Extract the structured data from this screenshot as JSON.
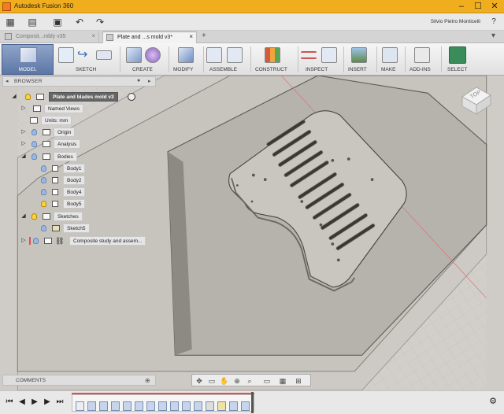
{
  "app": {
    "title": "Autodesk Fusion 360",
    "user": "Silvio Pietro Monticelli"
  },
  "tabs": [
    {
      "label": "Composit...mbly v35"
    },
    {
      "label": "Plate and ...s mold v3*"
    }
  ],
  "toolbar": {
    "mode": "MODEL",
    "groups": [
      {
        "label": "SKETCH"
      },
      {
        "label": "CREATE"
      },
      {
        "label": "MODIFY"
      },
      {
        "label": "ASSEMBLE"
      },
      {
        "label": "CONSTRUCT"
      },
      {
        "label": "INSPECT"
      },
      {
        "label": "INSERT"
      },
      {
        "label": "MAKE"
      },
      {
        "label": "ADD-INS"
      },
      {
        "label": "SELECT"
      }
    ]
  },
  "browser": {
    "header": "BROWSER",
    "nodes": [
      {
        "label": "Plate and blades mold v3"
      },
      {
        "label": "Named Views"
      },
      {
        "label": "Units: mm"
      },
      {
        "label": "Origin"
      },
      {
        "label": "Analysis"
      },
      {
        "label": "Bodies"
      },
      {
        "label": "Body1"
      },
      {
        "label": "Body2"
      },
      {
        "label": "Body4"
      },
      {
        "label": "Body5"
      },
      {
        "label": "Sketches"
      },
      {
        "label": "Sketch5"
      },
      {
        "label": "Composite study and assem..."
      }
    ]
  },
  "comments": {
    "label": "COMMENTS"
  },
  "viewcube": {
    "face": "TOP"
  },
  "colors": {
    "titlebar": "#f0ad1e",
    "mode": "#5c77a6",
    "select": "#3a8c5a"
  }
}
